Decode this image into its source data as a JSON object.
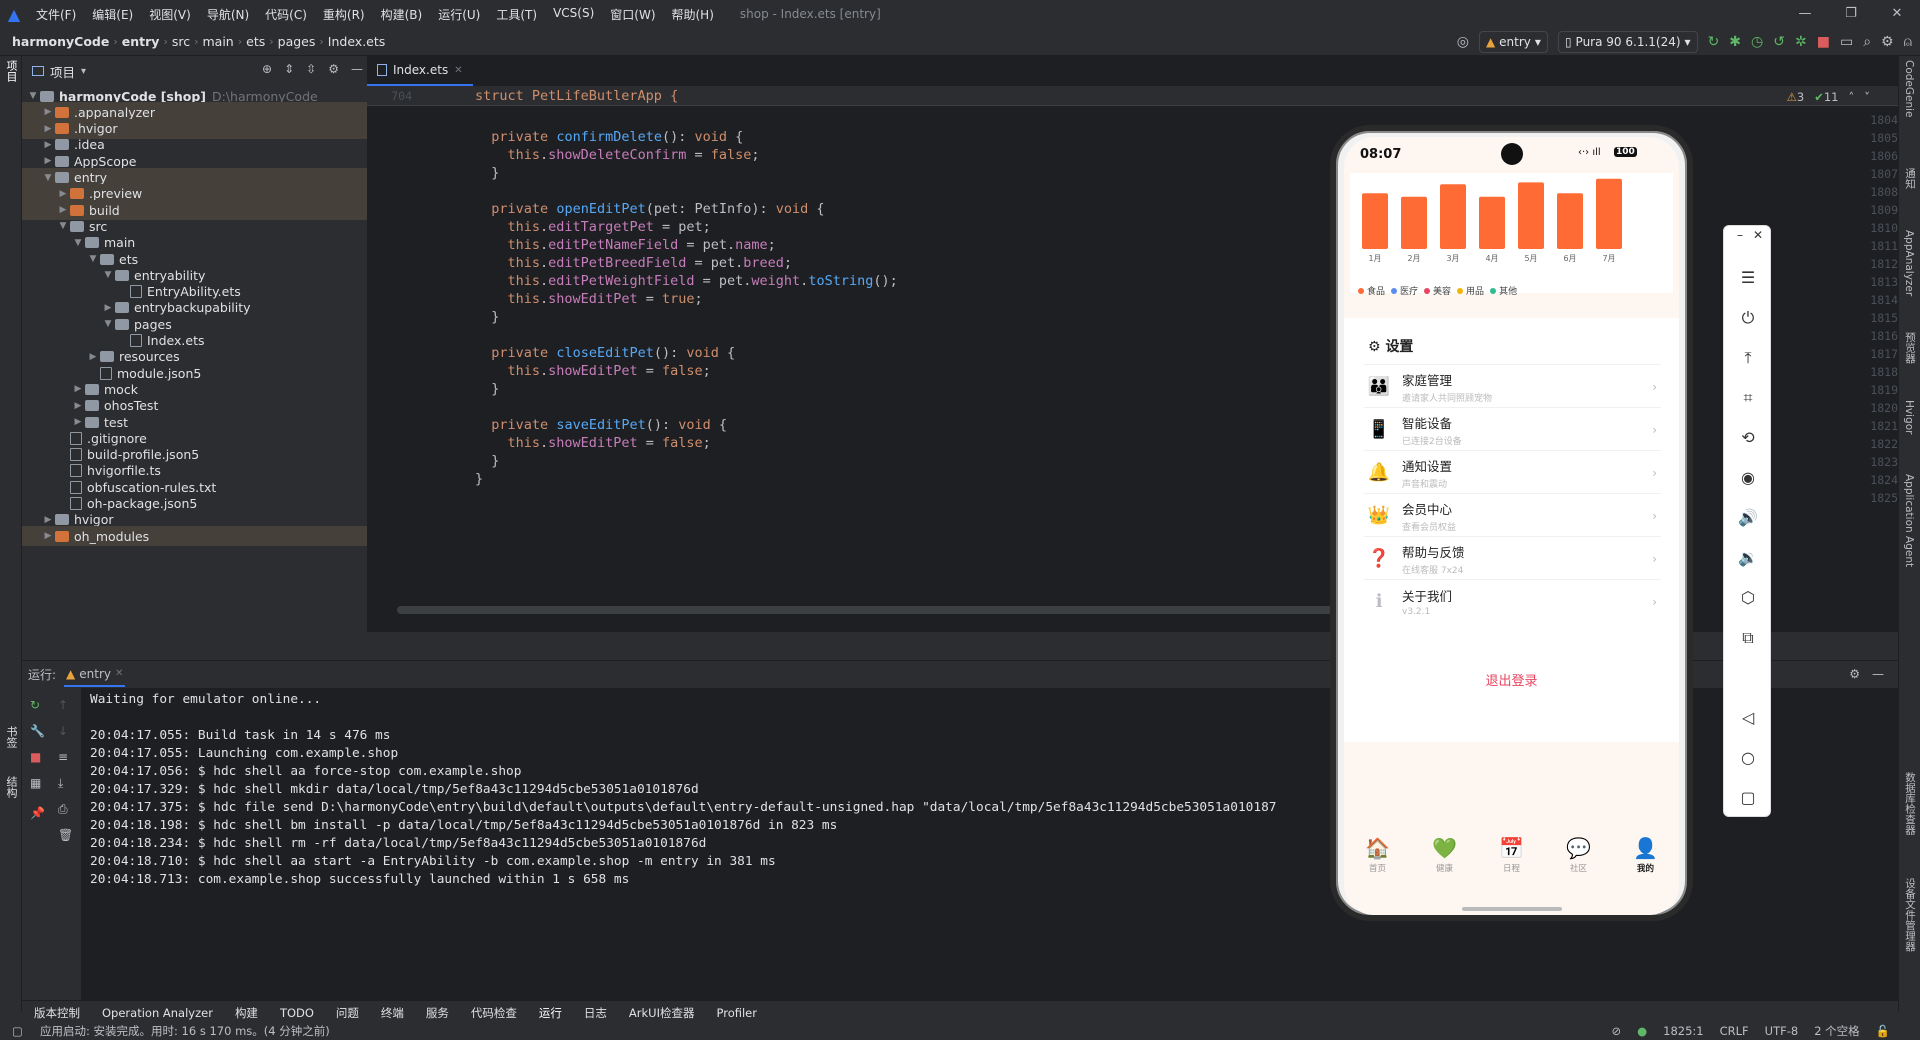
{
  "menu": {
    "items": [
      "文件(F)",
      "编辑(E)",
      "视图(V)",
      "导航(N)",
      "代码(C)",
      "重构(R)",
      "构建(B)",
      "运行(U)",
      "工具(T)",
      "VCS(S)",
      "窗口(W)",
      "帮助(H)"
    ],
    "window_title": "shop - Index.ets [entry]"
  },
  "breadcrumb": [
    "harmonyCode",
    "entry",
    "src",
    "main",
    "ets",
    "pages",
    "Index.ets"
  ],
  "toolbar": {
    "run_config": "entry",
    "device": "Pura 90 6.1.1(24)"
  },
  "project": {
    "title": "项目",
    "tree": [
      {
        "label": "harmonyCode [shop]",
        "extra": "D:\\harmonyCode",
        "depth": 0,
        "open": true,
        "kind": "folder",
        "hl": false
      },
      {
        "label": ".appanalyzer",
        "depth": 1,
        "open": false,
        "kind": "folder-o",
        "hl": true
      },
      {
        "label": ".hvigor",
        "depth": 1,
        "open": false,
        "kind": "folder-o",
        "hl": true
      },
      {
        "label": ".idea",
        "depth": 1,
        "open": false,
        "kind": "folder",
        "hl": false
      },
      {
        "label": "AppScope",
        "depth": 1,
        "open": false,
        "kind": "folder",
        "hl": false
      },
      {
        "label": "entry",
        "depth": 1,
        "open": true,
        "kind": "folder",
        "hl": true
      },
      {
        "label": ".preview",
        "depth": 2,
        "open": false,
        "kind": "folder-o",
        "hl": true
      },
      {
        "label": "build",
        "depth": 2,
        "open": false,
        "kind": "folder-o",
        "hl": true
      },
      {
        "label": "src",
        "depth": 2,
        "open": true,
        "kind": "folder",
        "hl": false
      },
      {
        "label": "main",
        "depth": 3,
        "open": true,
        "kind": "folder",
        "hl": false
      },
      {
        "label": "ets",
        "depth": 4,
        "open": true,
        "kind": "folder",
        "hl": false
      },
      {
        "label": "entryability",
        "depth": 5,
        "open": true,
        "kind": "folder",
        "hl": false
      },
      {
        "label": "EntryAbility.ets",
        "depth": 6,
        "open": null,
        "kind": "file",
        "hl": false
      },
      {
        "label": "entrybackupability",
        "depth": 5,
        "open": false,
        "kind": "folder",
        "hl": false
      },
      {
        "label": "pages",
        "depth": 5,
        "open": true,
        "kind": "folder",
        "hl": false
      },
      {
        "label": "Index.ets",
        "depth": 6,
        "open": null,
        "kind": "file",
        "hl": false
      },
      {
        "label": "resources",
        "depth": 4,
        "open": false,
        "kind": "folder",
        "hl": false
      },
      {
        "label": "module.json5",
        "depth": 4,
        "open": null,
        "kind": "file",
        "hl": false
      },
      {
        "label": "mock",
        "depth": 3,
        "open": false,
        "kind": "folder",
        "hl": false
      },
      {
        "label": "ohosTest",
        "depth": 3,
        "open": false,
        "kind": "folder",
        "hl": false
      },
      {
        "label": "test",
        "depth": 3,
        "open": false,
        "kind": "folder",
        "hl": false
      },
      {
        "label": ".gitignore",
        "depth": 2,
        "open": null,
        "kind": "file",
        "hl": false
      },
      {
        "label": "build-profile.json5",
        "depth": 2,
        "open": null,
        "kind": "file",
        "hl": false
      },
      {
        "label": "hvigorfile.ts",
        "depth": 2,
        "open": null,
        "kind": "file",
        "hl": false
      },
      {
        "label": "obfuscation-rules.txt",
        "depth": 2,
        "open": null,
        "kind": "file",
        "hl": false
      },
      {
        "label": "oh-package.json5",
        "depth": 2,
        "open": null,
        "kind": "file",
        "hl": false
      },
      {
        "label": "hvigor",
        "depth": 1,
        "open": false,
        "kind": "folder",
        "hl": false
      },
      {
        "label": "oh_modules",
        "depth": 1,
        "open": false,
        "kind": "folder-o",
        "hl": true
      }
    ]
  },
  "editor": {
    "tab": "Index.ets",
    "sticky_line_no": "704",
    "sticky_code": "struct PetLifeButlerApp {",
    "warnings": "3",
    "oks": "11",
    "lines": [
      {
        "n": "1803",
        "code": "  }"
      },
      {
        "n": "1804",
        "code": ""
      },
      {
        "n": "1805",
        "code": "  private confirmDelete(): void {"
      },
      {
        "n": "1806",
        "code": "    this.showDeleteConfirm = false;"
      },
      {
        "n": "1807",
        "code": "  }"
      },
      {
        "n": "1808",
        "code": ""
      },
      {
        "n": "1809",
        "code": "  private openEditPet(pet: PetInfo): void {"
      },
      {
        "n": "1810",
        "code": "    this.editTargetPet = pet;"
      },
      {
        "n": "1811",
        "code": "    this.editPetNameField = pet.name;"
      },
      {
        "n": "1812",
        "code": "    this.editPetBreedField = pet.breed;"
      },
      {
        "n": "1813",
        "code": "    this.editPetWeightField = pet.weight.toString();"
      },
      {
        "n": "1814",
        "code": "    this.showEditPet = true;"
      },
      {
        "n": "1815",
        "code": "  }"
      },
      {
        "n": "1816",
        "code": ""
      },
      {
        "n": "1817",
        "code": "  private closeEditPet(): void {"
      },
      {
        "n": "1818",
        "code": "    this.showEditPet = false;"
      },
      {
        "n": "1819",
        "code": "  }"
      },
      {
        "n": "1820",
        "code": ""
      },
      {
        "n": "1821",
        "code": "  private saveEditPet(): void {"
      },
      {
        "n": "1822",
        "code": "    this.showEditPet = false;"
      },
      {
        "n": "1823",
        "code": "  }"
      },
      {
        "n": "1824",
        "code": "}"
      },
      {
        "n": "1825",
        "code": ""
      }
    ]
  },
  "run": {
    "label": "运行:",
    "tab": "entry",
    "console": [
      "Waiting for emulator online...",
      "",
      "20:04:17.055: Build task in 14 s 476 ms",
      "20:04:17.055: Launching com.example.shop",
      "20:04:17.056: $ hdc shell aa force-stop com.example.shop",
      "20:04:17.329: $ hdc shell mkdir data/local/tmp/5ef8a43c11294d5cbe53051a0101876d",
      "20:04:17.375: $ hdc file send D:\\harmonyCode\\entry\\build\\default\\outputs\\default\\entry-default-unsigned.hap \"data/local/tmp/5ef8a43c11294d5cbe53051a010187",
      "20:04:18.198: $ hdc shell bm install -p data/local/tmp/5ef8a43c11294d5cbe53051a0101876d in 823 ms",
      "20:04:18.234: $ hdc shell rm -rf data/local/tmp/5ef8a43c11294d5cbe53051a0101876d",
      "20:04:18.710: $ hdc shell aa start -a EntryAbility -b com.example.shop -m entry in 381 ms",
      "20:04:18.713: com.example.shop successfully launched within 1 s 658 ms"
    ]
  },
  "toolwindows": [
    "版本控制",
    "Operation Analyzer",
    "构建",
    "TODO",
    "问题",
    "终端",
    "服务",
    "代码检查",
    "运行",
    "日志",
    "ArkUI检查器",
    "Profiler"
  ],
  "status": {
    "message": "应用启动: 安装完成。用时: 16 s 170 ms。(4 分钟之前)",
    "position": "1825:1",
    "line_sep": "CRLF",
    "encoding": "UTF-8",
    "indent": "2 个空格"
  },
  "left_strip": [
    "项目",
    "书签",
    "结构"
  ],
  "right_strip": [
    "CodeGenie",
    "通知",
    "AppAnalyzer",
    "预览器",
    "Hvigor",
    "Application Agent",
    "数据库检查器",
    "设备文件管理器"
  ],
  "phone": {
    "time": "08:07",
    "battery": "100",
    "chart_data": {
      "type": "bar",
      "categories": [
        "1月",
        "2月",
        "3月",
        "4月",
        "5月",
        "6月",
        "7月"
      ],
      "values": [
        62,
        58,
        72,
        58,
        74,
        62,
        78
      ],
      "ylim": [
        0,
        80
      ],
      "color": "#ff6b35"
    },
    "legend": [
      {
        "label": "食品",
        "color": "#ff6b35"
      },
      {
        "label": "医疗",
        "color": "#5b8def"
      },
      {
        "label": "美容",
        "color": "#e94560"
      },
      {
        "label": "用品",
        "color": "#f5b400"
      },
      {
        "label": "其他",
        "color": "#2fbd8f"
      }
    ],
    "settings_title": "设置",
    "settings": [
      {
        "icon": "👪",
        "title": "家庭管理",
        "sub": "邀请家人共同照顾宠物"
      },
      {
        "icon": "📱",
        "title": "智能设备",
        "sub": "已连接2台设备"
      },
      {
        "icon": "🔔",
        "title": "通知设置",
        "sub": "声音和震动"
      },
      {
        "icon": "👑",
        "title": "会员中心",
        "sub": "查看会员权益"
      },
      {
        "icon": "❓",
        "title": "帮助与反馈",
        "sub": "在线客服 7x24"
      },
      {
        "icon": "ℹ",
        "title": "关于我们",
        "sub": "v3.2.1"
      }
    ],
    "logout": "退出登录",
    "tabs": [
      {
        "icon": "🏠",
        "label": "首页",
        "active": false
      },
      {
        "icon": "💚",
        "label": "健康",
        "active": false
      },
      {
        "icon": "📅",
        "label": "日程",
        "active": false
      },
      {
        "icon": "💬",
        "label": "社区",
        "active": false
      },
      {
        "icon": "👤",
        "label": "我的",
        "active": true
      }
    ]
  }
}
